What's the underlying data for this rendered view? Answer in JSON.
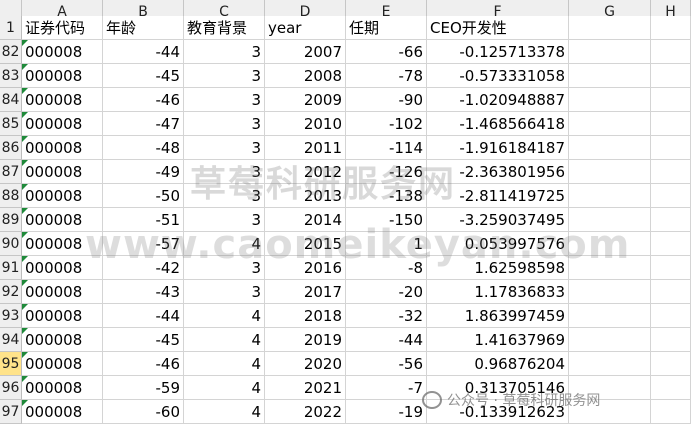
{
  "column_letters": [
    "A",
    "B",
    "C",
    "D",
    "E",
    "F",
    "G",
    "H"
  ],
  "header_row_number": "1",
  "headers": [
    "证券代码",
    "年龄",
    "教育背景",
    "year",
    "任期",
    "CEO开发性",
    "",
    ""
  ],
  "rows": [
    {
      "num": "82",
      "code": "000008",
      "age": "-44",
      "edu": "3",
      "year": "2007",
      "tenure": "-66",
      "ceo": "-0.125713378"
    },
    {
      "num": "83",
      "code": "000008",
      "age": "-45",
      "edu": "3",
      "year": "2008",
      "tenure": "-78",
      "ceo": "-0.573331058"
    },
    {
      "num": "84",
      "code": "000008",
      "age": "-46",
      "edu": "3",
      "year": "2009",
      "tenure": "-90",
      "ceo": "-1.020948887"
    },
    {
      "num": "85",
      "code": "000008",
      "age": "-47",
      "edu": "3",
      "year": "2010",
      "tenure": "-102",
      "ceo": "-1.468566418"
    },
    {
      "num": "86",
      "code": "000008",
      "age": "-48",
      "edu": "3",
      "year": "2011",
      "tenure": "-114",
      "ceo": "-1.916184187"
    },
    {
      "num": "87",
      "code": "000008",
      "age": "-49",
      "edu": "3",
      "year": "2012",
      "tenure": "-126",
      "ceo": "-2.363801956"
    },
    {
      "num": "88",
      "code": "000008",
      "age": "-50",
      "edu": "3",
      "year": "2013",
      "tenure": "-138",
      "ceo": "-2.811419725"
    },
    {
      "num": "89",
      "code": "000008",
      "age": "-51",
      "edu": "3",
      "year": "2014",
      "tenure": "-150",
      "ceo": "-3.259037495"
    },
    {
      "num": "90",
      "code": "000008",
      "age": "-57",
      "edu": "4",
      "year": "2015",
      "tenure": "1",
      "ceo": "0.053997576"
    },
    {
      "num": "91",
      "code": "000008",
      "age": "-42",
      "edu": "3",
      "year": "2016",
      "tenure": "-8",
      "ceo": "1.62598598"
    },
    {
      "num": "92",
      "code": "000008",
      "age": "-43",
      "edu": "3",
      "year": "2017",
      "tenure": "-20",
      "ceo": "1.17836833"
    },
    {
      "num": "93",
      "code": "000008",
      "age": "-44",
      "edu": "4",
      "year": "2018",
      "tenure": "-32",
      "ceo": "1.863997459"
    },
    {
      "num": "94",
      "code": "000008",
      "age": "-45",
      "edu": "4",
      "year": "2019",
      "tenure": "-44",
      "ceo": "1.41637969"
    },
    {
      "num": "95",
      "code": "000008",
      "age": "-46",
      "edu": "4",
      "year": "2020",
      "tenure": "-56",
      "ceo": "0.96876204"
    },
    {
      "num": "96",
      "code": "000008",
      "age": "-59",
      "edu": "4",
      "year": "2021",
      "tenure": "-7",
      "ceo": "0.313705146"
    },
    {
      "num": "97",
      "code": "000008",
      "age": "-60",
      "edu": "4",
      "year": "2022",
      "tenure": "-19",
      "ceo": "-0.133912623"
    }
  ],
  "selected_row": "95",
  "watermark": {
    "cn": "草莓科研服务网",
    "url": "www.caomeikeyan.com",
    "footer": "公众号 · 草莓科研服务网"
  },
  "colors": {
    "header_bg": "#efefef",
    "selected_row": "#ffe38a",
    "error_triangle": "#1f8a3a",
    "grid": "#d4d4d4"
  }
}
